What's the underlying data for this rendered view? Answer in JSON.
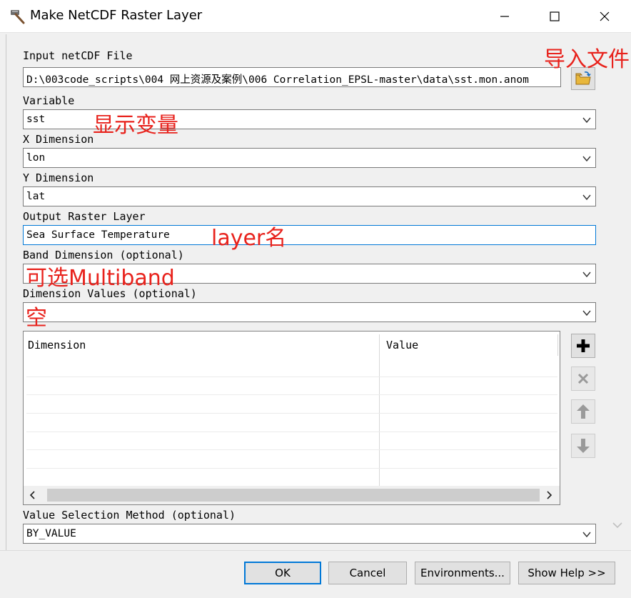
{
  "window": {
    "title": "Make NetCDF Raster Layer",
    "icon": "hammer-icon"
  },
  "fields": {
    "input_file": {
      "label": "Input netCDF File",
      "value": "D:\\003code_scripts\\004 网上资源及案例\\006 Correlation_EPSL-master\\data\\sst.mon.anom"
    },
    "variable": {
      "label": "Variable",
      "value": "sst"
    },
    "x_dimension": {
      "label": "X Dimension",
      "value": "lon"
    },
    "y_dimension": {
      "label": "Y Dimension",
      "value": "lat"
    },
    "output_layer": {
      "label": "Output Raster Layer",
      "value": "Sea Surface Temperature"
    },
    "band_dimension": {
      "label": "Band Dimension (optional)",
      "value": ""
    },
    "dimension_values": {
      "label": "Dimension Values (optional)",
      "value": ""
    },
    "value_selection": {
      "label": "Value Selection Method (optional)",
      "value": "BY_VALUE"
    }
  },
  "annotations": {
    "import_file": "导入文件",
    "show_variable": "显示变量",
    "layer_name": "layer名",
    "optional_multiband": "可选Multiband",
    "empty": "空"
  },
  "table": {
    "columns": [
      "Dimension",
      "Value"
    ]
  },
  "buttons": {
    "ok": "OK",
    "cancel": "Cancel",
    "environments": "Environments...",
    "show_help": "Show Help >>"
  },
  "colors": {
    "annotation": "#e8221c",
    "focus_border": "#0078d7"
  }
}
